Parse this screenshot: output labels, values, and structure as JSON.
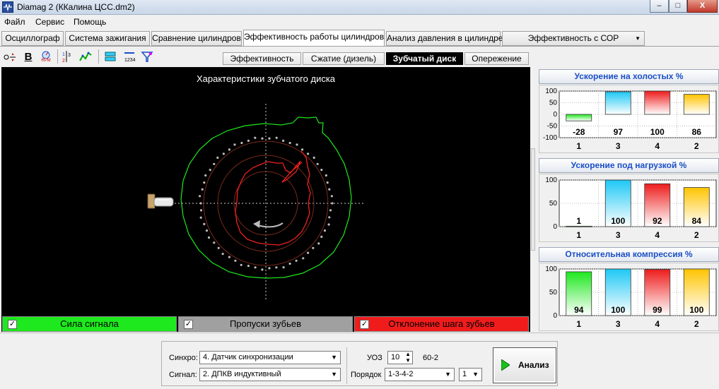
{
  "window": {
    "title": "Diamag 2 (ККалина ЦСС.dm2)",
    "min": "–",
    "max": "□",
    "close": "X"
  },
  "menu": [
    "Файл",
    "Сервис",
    "Помощь"
  ],
  "tabs": [
    "Осциллограф",
    "Система зажигания",
    "Сравнение цилиндров",
    "Эффективность работы цилиндров",
    "Анализ давления в цилиндре",
    "Эффективность с СОР"
  ],
  "toolbar": {
    "b_label": "B",
    "rpm_label": "RPM"
  },
  "subtabs": [
    "Эффективность",
    "Сжатие (дизель)",
    "Зубчатый диск",
    "Опережение"
  ],
  "plot": {
    "title": "Характеристики зубчатого диска"
  },
  "legend": [
    {
      "label": "Сила сигнала",
      "color": "#1ee81e",
      "check": "✓"
    },
    {
      "label": "Пропуски зубьев",
      "color": "#a0a0a0",
      "check": "✓"
    },
    {
      "label": "Отклонение шага зубьев",
      "color": "#f01c1c",
      "check": "✓"
    }
  ],
  "panels": [
    {
      "title": "Ускорение на холостых %",
      "ticks": [
        "100",
        "50",
        "0",
        "-50",
        "-100"
      ],
      "ymin": -100,
      "ymax": 100,
      "bars": [
        {
          "cyl": "1",
          "value": -28,
          "color": "green"
        },
        {
          "cyl": "3",
          "value": 97,
          "color": "cyan"
        },
        {
          "cyl": "4",
          "value": 100,
          "color": "red"
        },
        {
          "cyl": "2",
          "value": 86,
          "color": "yellow"
        }
      ]
    },
    {
      "title": "Ускорение под нагрузкой %",
      "ticks": [
        "100",
        "50",
        "0"
      ],
      "ymin": 0,
      "ymax": 100,
      "bars": [
        {
          "cyl": "1",
          "value": 1,
          "color": "green"
        },
        {
          "cyl": "3",
          "value": 100,
          "color": "cyan"
        },
        {
          "cyl": "4",
          "value": 92,
          "color": "red"
        },
        {
          "cyl": "2",
          "value": 84,
          "color": "yellow"
        }
      ]
    },
    {
      "title": "Относительная компрессия %",
      "ticks": [
        "100",
        "50",
        "0"
      ],
      "ymin": 0,
      "ymax": 100,
      "bars": [
        {
          "cyl": "1",
          "value": 94,
          "color": "green"
        },
        {
          "cyl": "3",
          "value": 100,
          "color": "cyan"
        },
        {
          "cyl": "4",
          "value": 99,
          "color": "red"
        },
        {
          "cyl": "2",
          "value": 100,
          "color": "yellow"
        }
      ]
    }
  ],
  "controls": {
    "sync_label": "Синхро:",
    "sync_value": "4.  Датчик синхронизации",
    "signal_label": "Сигнал:",
    "signal_value": "2.  ДПКВ индуктивный",
    "uoz_label": "УОЗ",
    "uoz_value": "10",
    "wheel": "60-2",
    "order_label": "Порядок",
    "order_value": "1-3-4-2",
    "cyl_value": "1",
    "analyze": "Анализ"
  }
}
